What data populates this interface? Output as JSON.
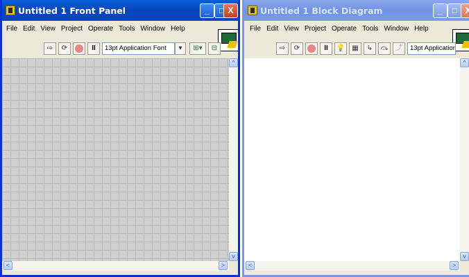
{
  "front_panel": {
    "title": "Untitled 1 Front Panel",
    "menus": [
      "File",
      "Edit",
      "View",
      "Project",
      "Operate",
      "Tools",
      "Window",
      "Help"
    ],
    "toolbar": {
      "run_icon": "run-arrow-icon",
      "run_continuous_icon": "run-continuously-icon",
      "abort_icon": "abort-icon",
      "pause_label": "II",
      "font_value": "13pt Application Font"
    },
    "caption_buttons": {
      "minimize": "_",
      "maximize": "□",
      "close": "X"
    }
  },
  "block_diagram": {
    "title": "Untitled 1 Block Diagram",
    "menus": [
      "File",
      "Edit",
      "View",
      "Project",
      "Operate",
      "Tools",
      "Window",
      "Help"
    ],
    "toolbar": {
      "pause_label": "II",
      "font_value": "13pt Application"
    },
    "caption_buttons": {
      "minimize": "_",
      "maximize": "□",
      "close": "X"
    }
  },
  "scroll": {
    "up": "^",
    "down": "v",
    "left": "<",
    "right": ">"
  }
}
